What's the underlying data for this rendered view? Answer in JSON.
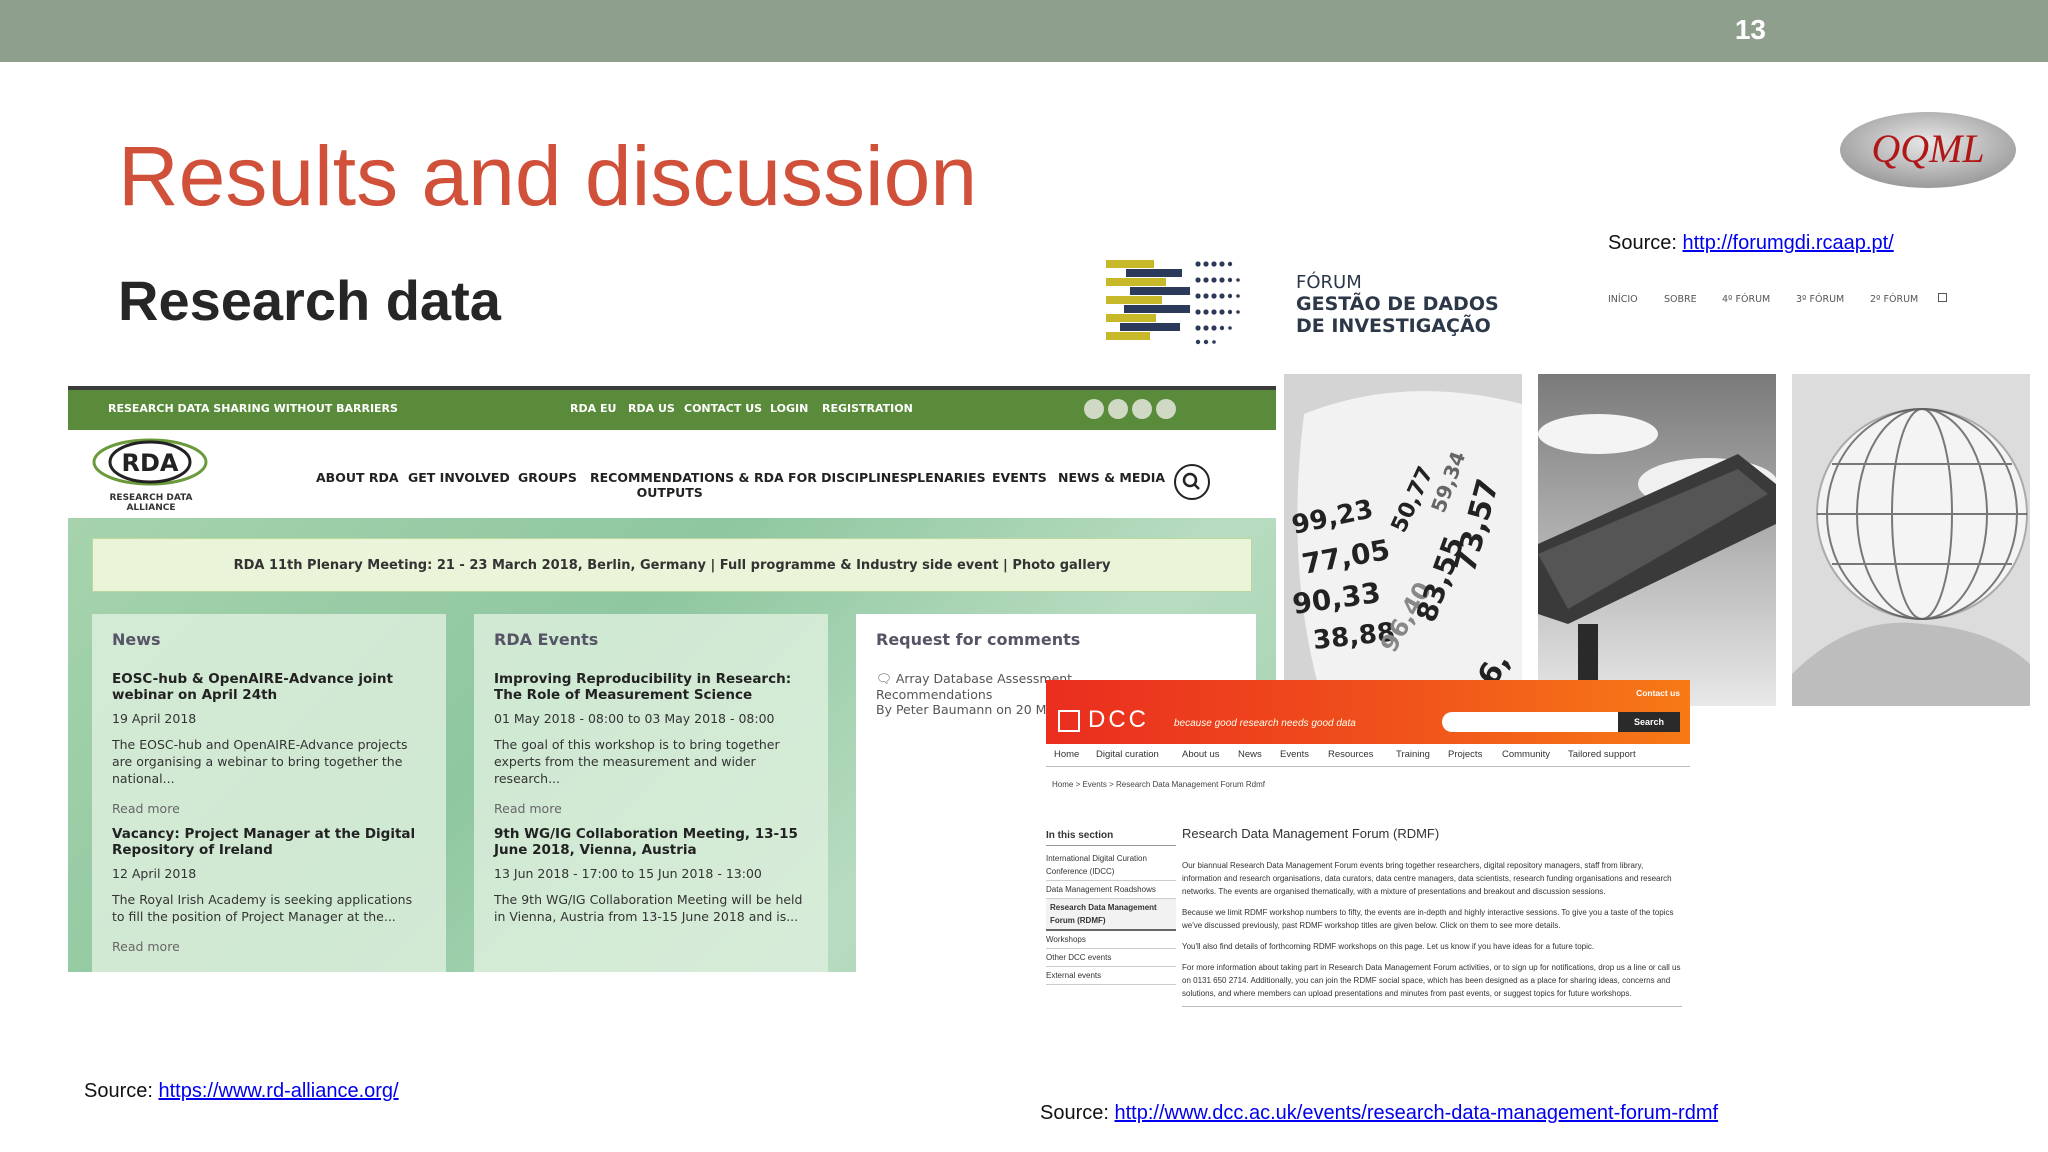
{
  "slide": {
    "number": "13",
    "title": "Results and discussion",
    "subtitle": "Research data",
    "logo_text": "QQML"
  },
  "sources": {
    "forum": {
      "label": "Source: ",
      "url": "http://forumgdi.rcaap.pt/"
    },
    "rda": {
      "label": "Source: ",
      "url": "https://www.rd-alliance.org/"
    },
    "dcc": {
      "label": "Source: ",
      "url": "http://www.dcc.ac.uk/events/research-data-management-forum-rdmf"
    }
  },
  "forum": {
    "title_line1": "FÓRUM",
    "title_line2": "GESTÃO DE DADOS",
    "title_line3": "DE INVESTIGAÇÃO",
    "nav": [
      "INÍCIO",
      "SOBRE",
      "4º FÓRUM",
      "3º FÓRUM",
      "2º FÓRUM"
    ]
  },
  "rda": {
    "tagline": "RESEARCH DATA SHARING WITHOUT BARRIERS",
    "top_links": [
      "RDA EU",
      "RDA US",
      "CONTACT US",
      "LOGIN",
      "REGISTRATION"
    ],
    "logo_text": "RDA",
    "logo_sub": "RESEARCH DATA ALLIANCE",
    "nav": [
      "ABOUT RDA",
      "GET INVOLVED",
      "GROUPS",
      "RECOMMENDATIONS &",
      "OUTPUTS",
      "RDA FOR DISCIPLINES",
      "PLENARIES",
      "EVENTS",
      "NEWS & MEDIA"
    ],
    "banner": "RDA 11th Plenary Meeting: 21 - 23 March 2018, Berlin, Germany | Full programme & Industry side event  | Photo gallery",
    "news": {
      "heading": "News",
      "items": [
        {
          "title": "EOSC-hub & OpenAIRE-Advance joint webinar on April 24th",
          "date": "19 April 2018",
          "text": "The EOSC-hub and OpenAIRE-Advance projects are organising a webinar to bring together the national...",
          "more": "Read more"
        },
        {
          "title": "Vacancy: Project Manager at the Digital Repository of Ireland",
          "date": "12 April 2018",
          "text": "The Royal Irish Academy is seeking applications to fill the position of Project Manager at the...",
          "more": "Read more"
        }
      ]
    },
    "events": {
      "heading": "RDA Events",
      "items": [
        {
          "title": "Improving Reproducibility in Research: The Role of Measurement Science",
          "date": "01 May 2018 - 08:00 to 03 May 2018 - 08:00",
          "text": "The goal of this workshop is to bring together experts from the measurement and wider research...",
          "more": "Read more"
        },
        {
          "title": "9th WG/IG Collaboration Meeting, 13-15 June 2018, Vienna, Austria",
          "date": "13 Jun 2018 - 17:00 to 15 Jun 2018 - 13:00",
          "text": "The 9th WG/IG Collaboration Meeting will be held in Vienna, Austria from 13-15 June 2018 and is..."
        }
      ]
    },
    "rfc": {
      "heading": "Request for comments",
      "lines": [
        "Array Database Assessment",
        "Recommendations",
        "By Peter Baumann on 20 M"
      ]
    }
  },
  "dcc": {
    "logo": "DCC",
    "tagline": "because good research needs good data",
    "contact": "Contact us",
    "search_button": "Search",
    "nav": [
      "Home",
      "Digital curation",
      "About us",
      "News",
      "Events",
      "Resources",
      "Training",
      "Projects",
      "Community",
      "Tailored support"
    ],
    "breadcrumb": "Home > Events > Research Data Management Forum Rdmf",
    "side_heading": "In this section",
    "side_items": [
      "International Digital Curation Conference (IDCC)",
      "Data Management Roadshows",
      "Research Data Management Forum (RDMF)",
      "Workshops",
      "Other DCC events",
      "External events"
    ],
    "page_heading": "Research Data Management Forum (RDMF)",
    "paragraphs": [
      "Our biannual Research Data Management Forum events bring together researchers, digital repository managers, staff from library, information and research organisations, data curators, data centre managers, data scientists, research funding organisations and research networks. The events are organised thematically, with a mixture of presentations and breakout and discussion sessions.",
      "Because we limit RDMF workshop numbers to fifty, the events are in-depth and highly interactive sessions. To give you a taste of the topics we've discussed previously, past RDMF workshop titles are given below. Click on them to see more details.",
      "You'll also find details of forthcoming RDMF workshops on this page. Let us know if you have ideas for a future topic.",
      "For more information about taking part in Research Data Management Forum activities, or to sign up for notifications, drop us a line or call us on 0131 650 2714. Additionally, you can join the RDMF social space, which has been designed as a place for sharing ideas, concerns and solutions, and where members can upload presentations and minutes from past events, or suggest topics for future workshops."
    ]
  },
  "colors": {
    "title": "#d0503a",
    "topbar": "#8e9f8e",
    "rda_green": "#5a8b3a",
    "dcc_red": "#ea2d1f"
  }
}
